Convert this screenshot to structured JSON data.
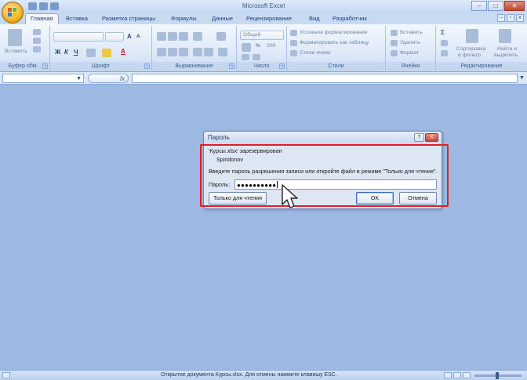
{
  "app": {
    "title": "Microsoft Excel"
  },
  "tabs": [
    "Главная",
    "Вставка",
    "Разметка страницы",
    "Формулы",
    "Данные",
    "Рецензирование",
    "Вид",
    "Разработчик"
  ],
  "ribbon": {
    "groups": {
      "clipboard": "Буфер обм...",
      "font": "Шрифт",
      "alignment": "Выравнивание",
      "number": "Число",
      "styles": "Стили",
      "cells": "Ячейки",
      "editing": "Редактирование"
    },
    "paste": "Вставить",
    "bold": "Ж",
    "italic": "К",
    "underline": "Ч",
    "grow_font": "A",
    "shrink_font": "A",
    "number_format": "Общий",
    "percent": "%",
    "thousands": "000",
    "conditional_formatting": "Условное форматирование",
    "format_as_table": "Форматировать как таблицу",
    "cell_styles": "Стили ячеек",
    "insert": "Вставить",
    "delete": "Удалить",
    "format": "Формат",
    "sigma": "Σ",
    "sort_filter_1": "Сортировка",
    "sort_filter_2": "и фильтр",
    "find_select_1": "Найти и",
    "find_select_2": "выделить"
  },
  "formula_bar": {
    "fx": "fx"
  },
  "dialog": {
    "title": "Пароль",
    "help": "?",
    "close": "X",
    "reserved_line": "'Курсы.xlsx' зарезервирован",
    "user": "Spiridonov",
    "instruction": "Введите пароль разрешения записи или откройте файл в режиме \"Только для чтения\".",
    "password_label": "Пароль:",
    "password_value": "●●●●●●●●●●",
    "read_only_button": "Только для чтения",
    "ok_button": "OK",
    "cancel_button": "Отмена"
  },
  "status": {
    "message": "Открытие документа Курсы.xlsx. Для отмены нажмите клавишу ESC."
  },
  "colors": {
    "highlight": "#e02020",
    "workspace": "#9db9e3"
  }
}
